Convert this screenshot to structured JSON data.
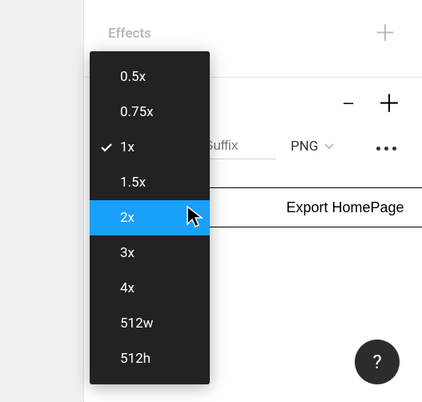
{
  "effects": {
    "title": "Effects"
  },
  "export": {
    "suffix_placeholder": "Suffix",
    "format": "PNG",
    "button_label": "Export HomePage"
  },
  "scale_menu": {
    "selected": "1x",
    "highlighted": "2x",
    "options": [
      "0.5x",
      "0.75x",
      "1x",
      "1.5x",
      "2x",
      "3x",
      "4x",
      "512w",
      "512h"
    ]
  },
  "help": {
    "label": "?"
  }
}
